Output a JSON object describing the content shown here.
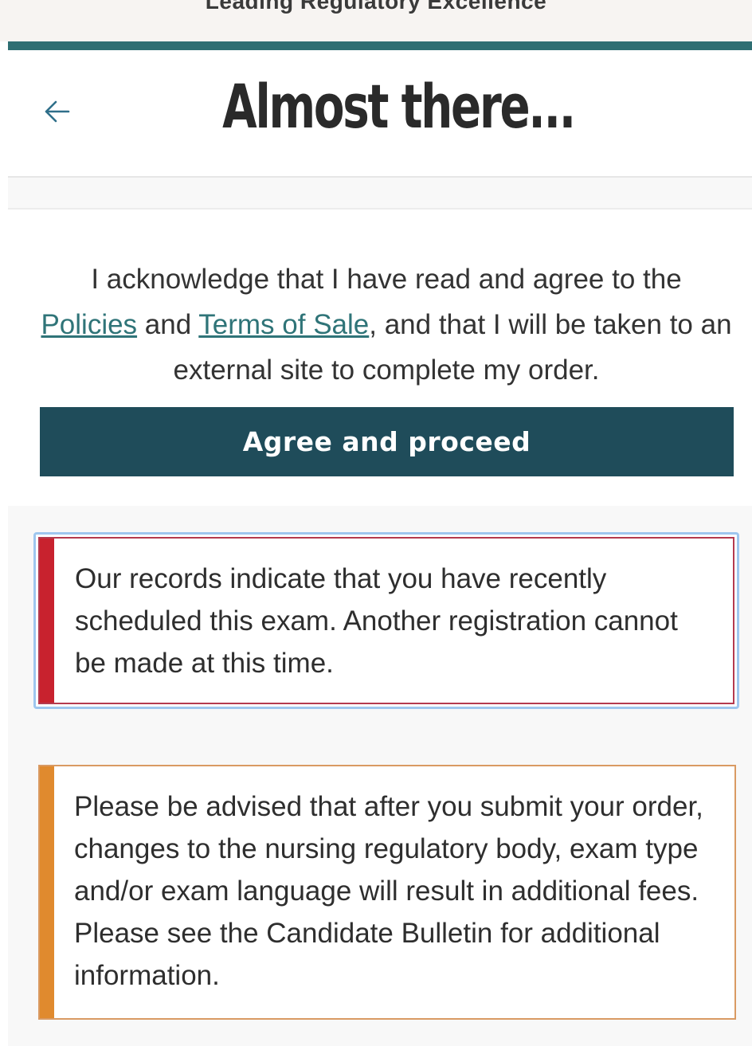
{
  "top_strip": {
    "tagline": "Leading Regulatory Excellence"
  },
  "header": {
    "title": "Almost there...",
    "back_icon": "arrow-left-icon"
  },
  "acknowledgement": {
    "text_before": "I acknowledge that I have read and agree to the ",
    "policies_link": "Policies",
    "text_and": " and ",
    "terms_link": "Terms of Sale",
    "text_after": ", and that I will be taken to an external site to complete my order."
  },
  "agree_button": {
    "label": "Agree and proceed"
  },
  "alerts": {
    "error_message": "Our records indicate that you have recently scheduled this exam. Another registration cannot be made at this time.",
    "warning_message": "Please be advised that after you submit your order, changes to the nursing regulatory body, exam type and/or exam language will result in additional fees. Please see the Candidate Bulletin for additional information."
  },
  "colors": {
    "accent_bar": "#2f6f73",
    "button_bg": "#1f4c5a",
    "link": "#2f7478",
    "error_stripe": "#c8222e",
    "focus_border": "#9ec6ee",
    "warning_stripe": "#e08a2e"
  }
}
